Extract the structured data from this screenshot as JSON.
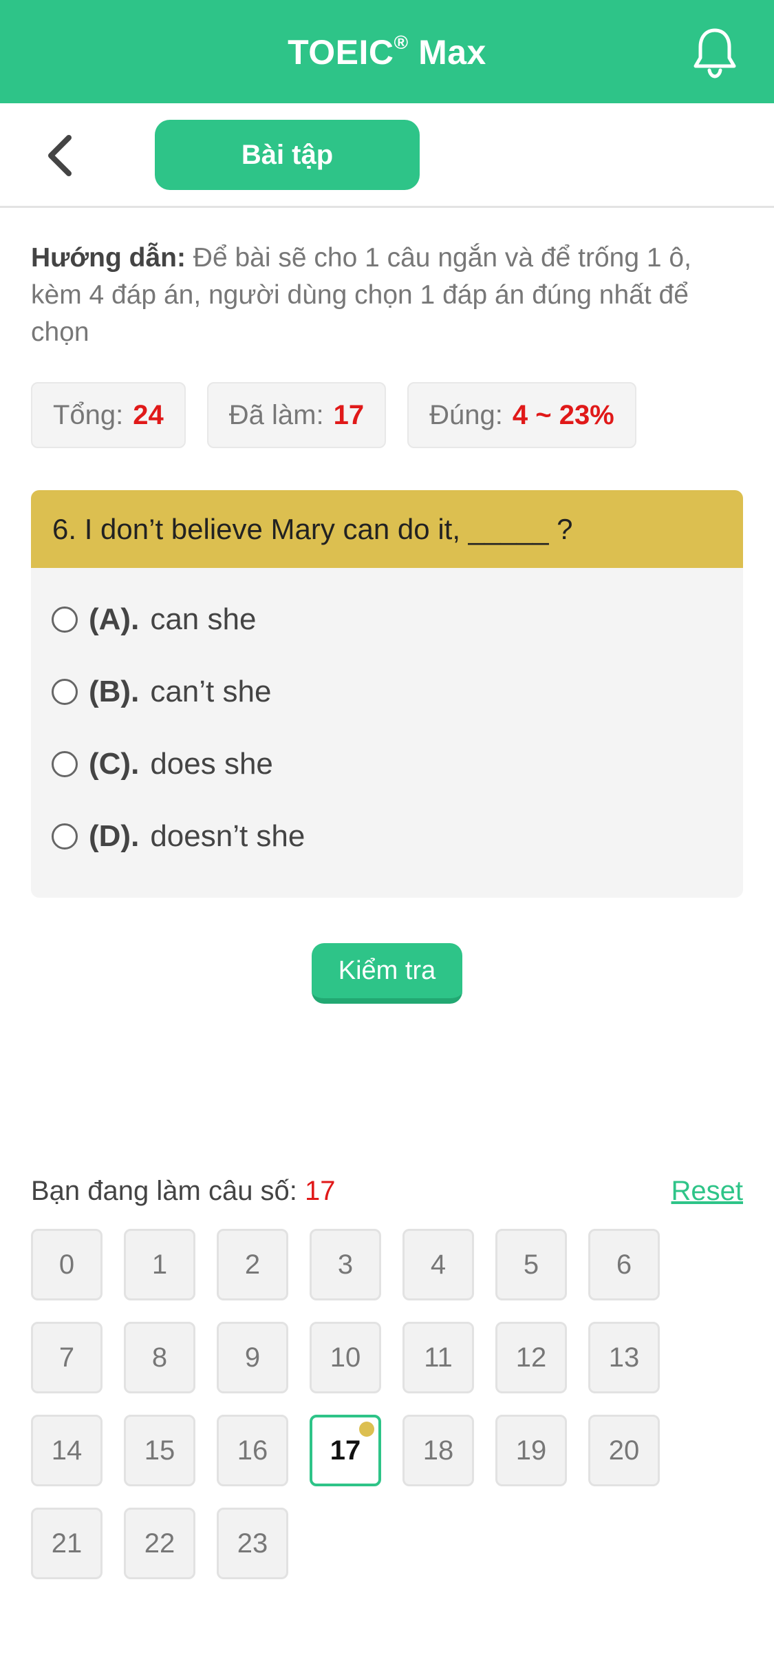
{
  "app": {
    "title": "TOEIC",
    "title_mark": "®",
    "title_suffix": "Max"
  },
  "header": {
    "bell_icon": "bell-icon"
  },
  "toolbar": {
    "back_icon": "chevron-left-icon",
    "tab_label": "Bài tập"
  },
  "guide": {
    "label": "Hướng dẫn:",
    "text": "Để bài sẽ cho 1 câu ngắn và để trống 1 ô, kèm 4 đáp án, người dùng chọn 1 đáp án đúng nhất để chọn"
  },
  "stats": [
    {
      "label": "Tổng:",
      "value": "24"
    },
    {
      "label": "Đã làm:",
      "value": "17"
    },
    {
      "label": "Đúng:",
      "value": "4 ~ 23%"
    }
  ],
  "question": {
    "text": "6. I don’t believe Mary can do it, _____ ?",
    "options": [
      {
        "letter": "(A).",
        "text": "can she"
      },
      {
        "letter": "(B).",
        "text": "can’t she"
      },
      {
        "letter": "(C).",
        "text": "does she"
      },
      {
        "letter": "(D).",
        "text": "doesn’t she"
      }
    ]
  },
  "check_label": "Kiểm tra",
  "progress": {
    "label": "Bạn đang làm câu số:",
    "current": "17",
    "reset_label": "Reset"
  },
  "questions_grid": [
    "0",
    "1",
    "2",
    "3",
    "4",
    "5",
    "6",
    "7",
    "8",
    "9",
    "10",
    "11",
    "12",
    "13",
    "14",
    "15",
    "16",
    "17",
    "18",
    "19",
    "20",
    "21",
    "22",
    "23"
  ],
  "colors": {
    "brand": "#2ec488",
    "question_header": "#dcbf50",
    "highlight": "#e01919"
  }
}
